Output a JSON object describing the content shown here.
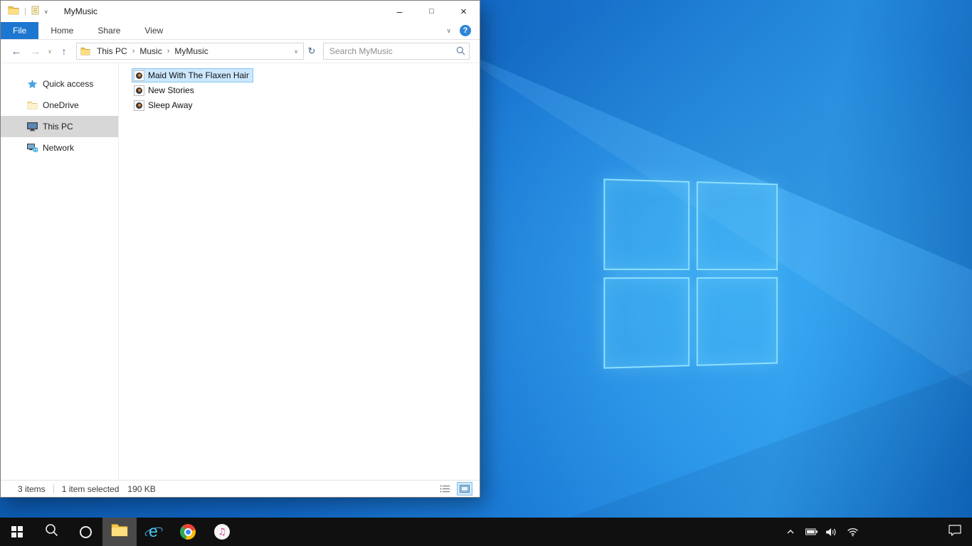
{
  "window": {
    "title": "MyMusic",
    "controls": {
      "minimize": "–",
      "maximize": "□",
      "close": "×"
    }
  },
  "icons": {
    "separator": "|",
    "chevron_down": "∨",
    "back": "←",
    "forward": "→",
    "up": "↑",
    "refresh": "↻",
    "breadcrumb_separator": "›",
    "help": "?",
    "ie_letter": "e",
    "music_note": "♫"
  },
  "ribbon": {
    "tabs": [
      {
        "label": "File",
        "active": true
      },
      {
        "label": "Home",
        "active": false
      },
      {
        "label": "Share",
        "active": false
      },
      {
        "label": "View",
        "active": false
      }
    ]
  },
  "address_bar": {
    "crumbs": [
      "This PC",
      "Music",
      "MyMusic"
    ],
    "search_placeholder": "Search MyMusic"
  },
  "sidebar": {
    "items": [
      {
        "label": "Quick access",
        "icon": "star-icon",
        "selected": false
      },
      {
        "label": "OneDrive",
        "icon": "onedrive-folder-icon",
        "selected": false
      },
      {
        "label": "This PC",
        "icon": "computer-icon",
        "selected": true
      },
      {
        "label": "Network",
        "icon": "network-icon",
        "selected": false
      }
    ]
  },
  "files": [
    {
      "name": "Maid With The Flaxen Hair",
      "icon": "audio-file-icon",
      "selected": true
    },
    {
      "name": "New Stories",
      "icon": "audio-file-icon",
      "selected": false
    },
    {
      "name": "Sleep Away",
      "icon": "audio-file-icon",
      "selected": false
    }
  ],
  "status_bar": {
    "items_count": "3 items",
    "selection": "1 item selected",
    "selection_size": "190 KB"
  },
  "taskbar": {
    "apps": [
      "start",
      "search",
      "cortana",
      "file-explorer",
      "internet-explorer",
      "chrome",
      "itunes"
    ],
    "active_app": "file-explorer",
    "tray": [
      "hidden-icons-chevron",
      "battery",
      "volume",
      "network"
    ],
    "action_center": "action-center"
  },
  "colors": {
    "file_tab_blue": "#1d76cf",
    "selection_fill": "#cce8ff",
    "selection_border": "#84c5f3",
    "sidebar_selected": "#d7d7d7",
    "taskbar_bg": "#101010",
    "desktop_blue": "#1d7fd9"
  }
}
